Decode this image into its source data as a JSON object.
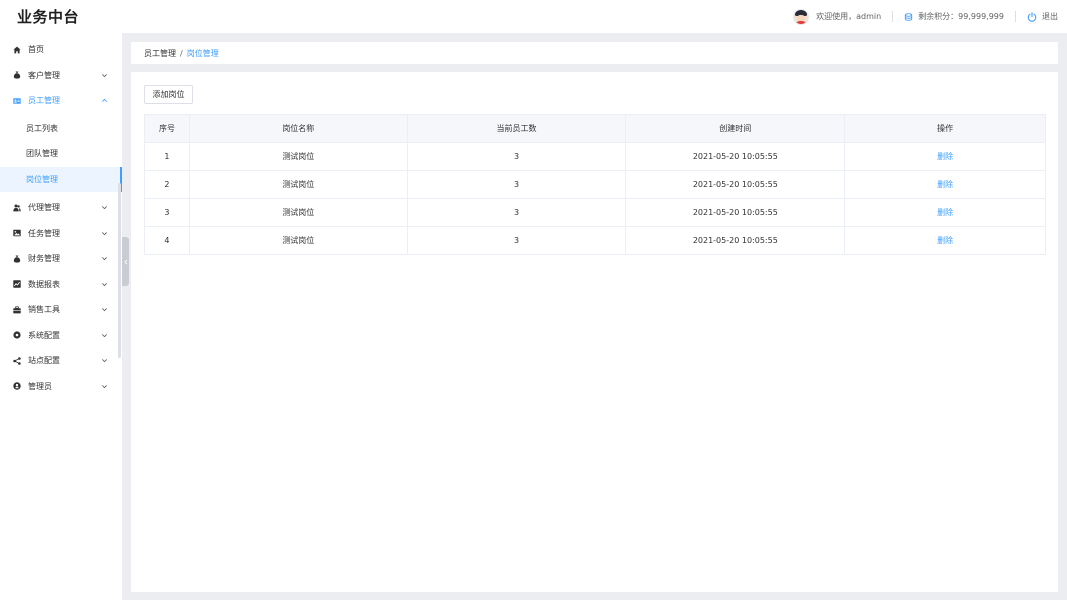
{
  "header": {
    "logo": "业务中台",
    "welcome": "欢迎使用，admin",
    "points": "剩余积分：99,999,999",
    "logout": "退出"
  },
  "sidebar": {
    "home": "首页",
    "customer": "客户管理",
    "employee": "员工管理",
    "employee_sub": [
      "员工列表",
      "团队管理",
      "岗位管理"
    ],
    "agent": "代理管理",
    "task": "任务管理",
    "finance": "财务管理",
    "report": "数据报表",
    "sales": "销售工具",
    "system": "系统配置",
    "site": "站点配置",
    "admin": "管理员"
  },
  "breadcrumb": {
    "parent": "员工管理",
    "sep": "/",
    "current": "岗位管理"
  },
  "toolbar": {
    "add_label": "添加岗位"
  },
  "table": {
    "headers": [
      "序号",
      "岗位名称",
      "当前员工数",
      "创建时间",
      "操作"
    ],
    "rows": [
      {
        "no": "1",
        "name": "测试岗位",
        "count": "3",
        "time": "2021-05-20 10:05:55",
        "action": "删除"
      },
      {
        "no": "2",
        "name": "测试岗位",
        "count": "3",
        "time": "2021-05-20 10:05:55",
        "action": "删除"
      },
      {
        "no": "3",
        "name": "测试岗位",
        "count": "3",
        "time": "2021-05-20 10:05:55",
        "action": "删除"
      },
      {
        "no": "4",
        "name": "测试岗位",
        "count": "3",
        "time": "2021-05-20 10:05:55",
        "action": "删除"
      }
    ]
  },
  "colors": {
    "accent": "#409eff",
    "text": "#303133",
    "border": "#ebeef5",
    "background": "#ebedf1"
  }
}
